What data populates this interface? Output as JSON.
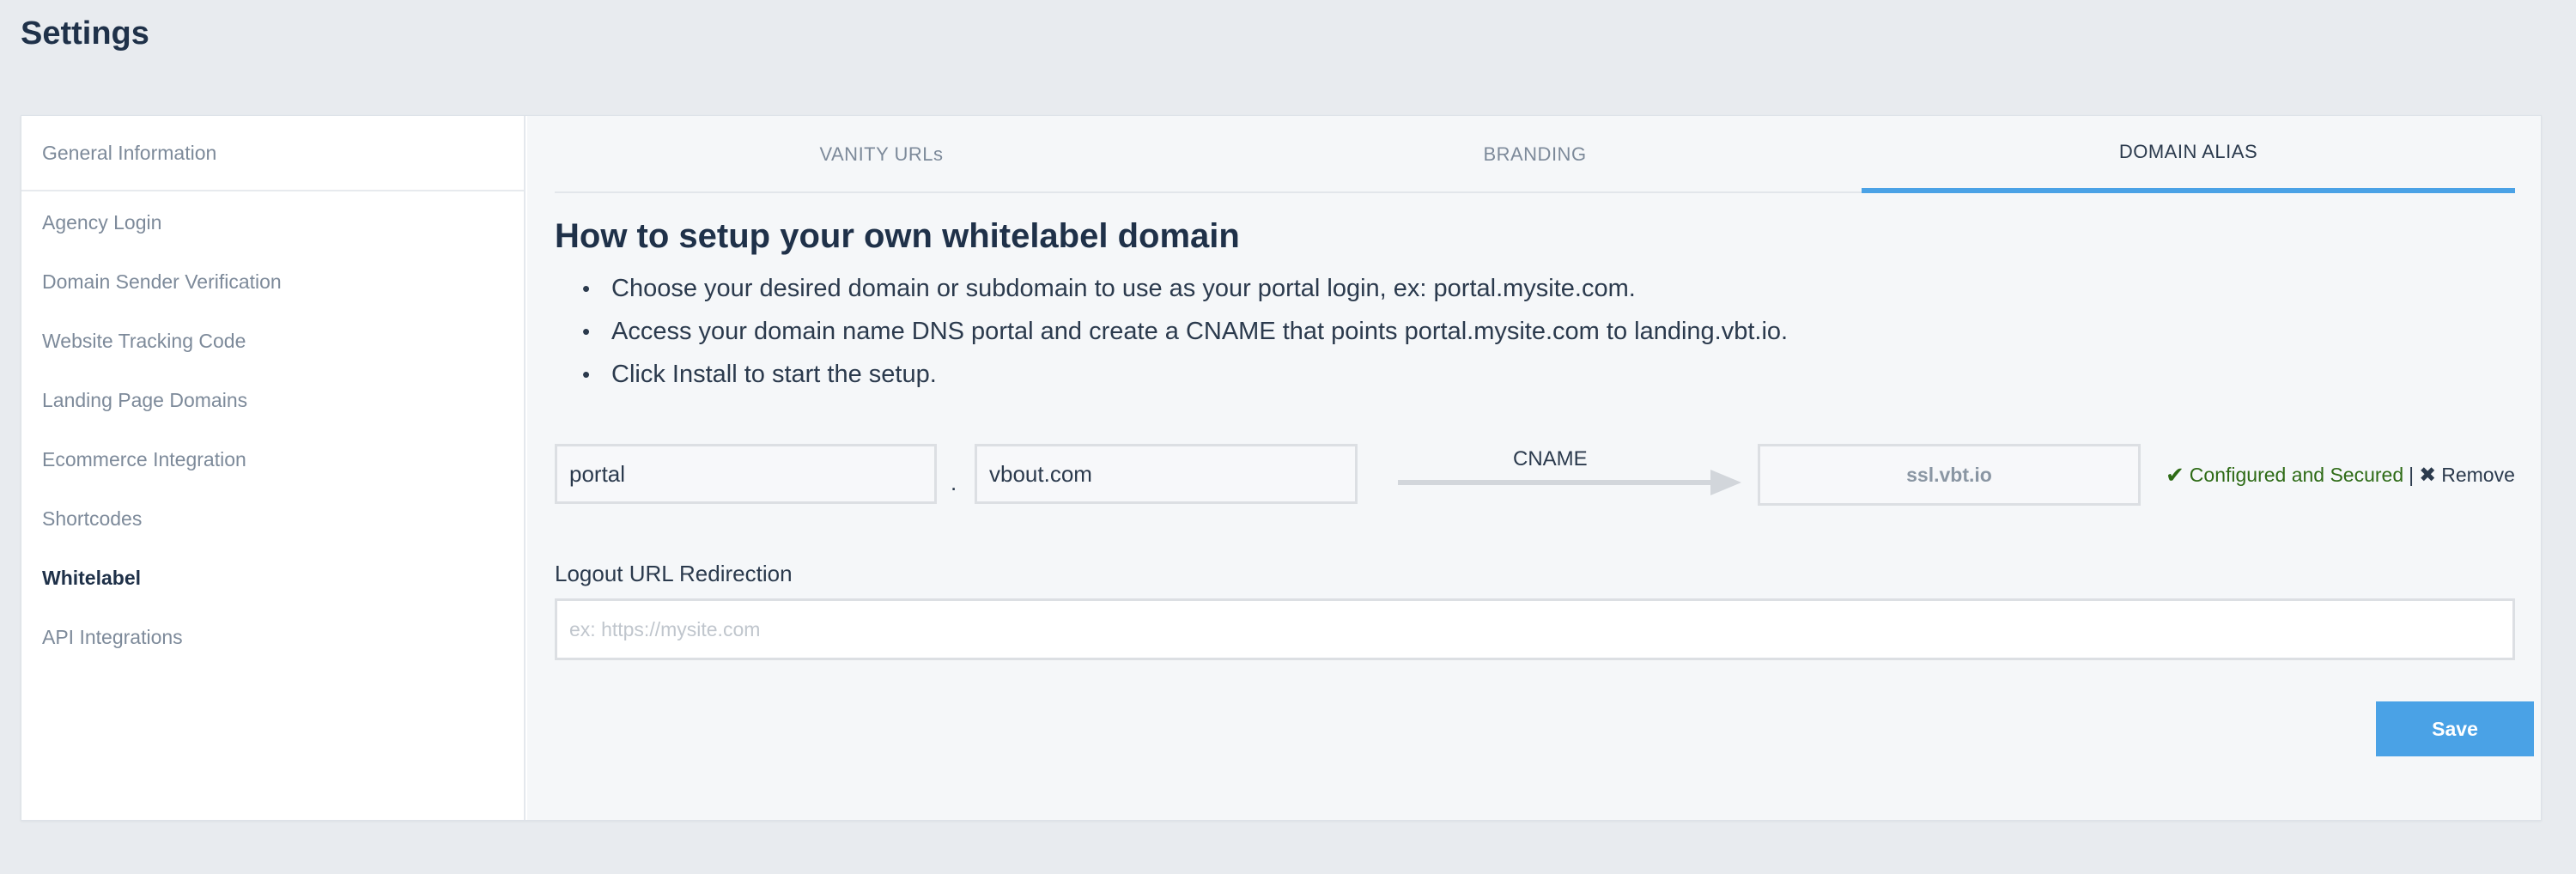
{
  "page": {
    "title": "Settings"
  },
  "sidebar": {
    "items": [
      {
        "label": "General Information"
      },
      {
        "label": "Agency Login"
      },
      {
        "label": "Domain Sender Verification"
      },
      {
        "label": "Website Tracking Code"
      },
      {
        "label": "Landing Page Domains"
      },
      {
        "label": "Ecommerce Integration"
      },
      {
        "label": "Shortcodes"
      },
      {
        "label": "Whitelabel",
        "active": true
      },
      {
        "label": "API Integrations"
      }
    ]
  },
  "tabs": [
    {
      "label": "VANITY URLs"
    },
    {
      "label": "BRANDING"
    },
    {
      "label": "DOMAIN ALIAS",
      "active": true
    }
  ],
  "setup": {
    "heading": "How to setup your own whitelabel domain",
    "steps": [
      "Choose your desired domain or subdomain to use as your portal login, ex: portal.mysite.com.",
      "Access your domain name DNS portal and create a CNAME that points portal.mysite.com to landing.vbt.io.",
      "Click Install to start the setup."
    ]
  },
  "domain": {
    "subdomain_value": "portal",
    "separator": ".",
    "domain_value": "vbout.com",
    "record_type": "CNAME",
    "target": "ssl.vbt.io",
    "status_text": "Configured and Secured",
    "divider": "|",
    "remove_label": "Remove"
  },
  "logout": {
    "label": "Logout URL Redirection",
    "placeholder": "ex: https://mysite.com",
    "value": ""
  },
  "actions": {
    "save_label": "Save"
  },
  "colors": {
    "accent": "#4aa2e6",
    "success": "#2e6b16",
    "background": "#e8ebef"
  }
}
